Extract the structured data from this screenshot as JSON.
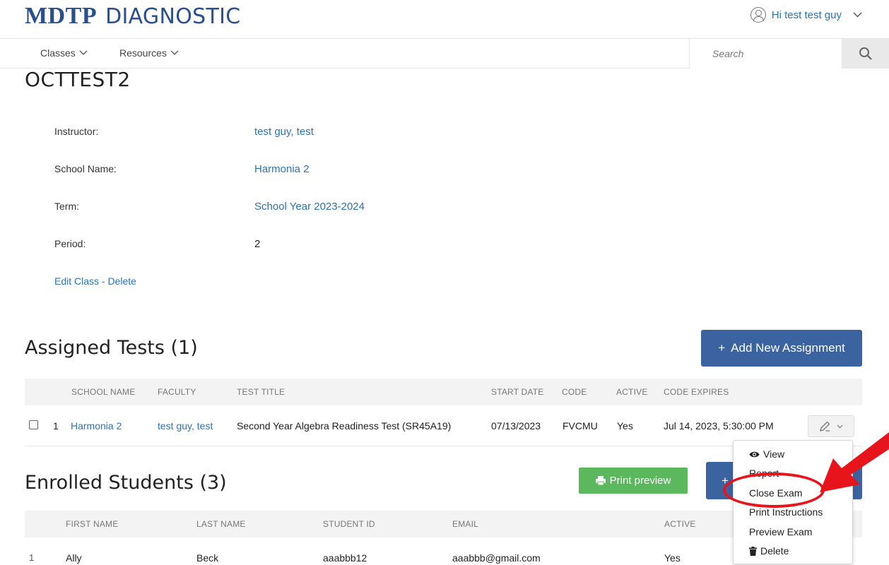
{
  "header": {
    "logo_main": "MDTP",
    "logo_sub": "DIAGNOSTIC",
    "user_greeting": "Hi test test guy"
  },
  "nav": {
    "classes": "Classes",
    "resources": "Resources",
    "search_placeholder": "Search"
  },
  "page": {
    "title": "OCTTEST2"
  },
  "class_info": {
    "instructor_label": "Instructor:",
    "instructor_value": "test guy, test",
    "school_label": "School Name:",
    "school_value": "Harmonia 2",
    "term_label": "Term:",
    "term_value": "School Year 2023-2024",
    "period_label": "Period:",
    "period_value": "2",
    "edit_link": "Edit Class",
    "separator": " - ",
    "delete_link": "Delete"
  },
  "assigned": {
    "title": "Assigned Tests (1)",
    "add_button": "Add New Assignment",
    "add_plus": "+",
    "columns": [
      "SCHOOL NAME",
      "FACULTY",
      "TEST TITLE",
      "START DATE",
      "CODE",
      "ACTIVE",
      "CODE EXPIRES"
    ],
    "rows": [
      {
        "index": "1",
        "school": "Harmonia 2",
        "faculty": "test guy, test",
        "test_title": "Second Year Algebra Readiness Test (SR45A19)",
        "start_date": "07/13/2023",
        "code": "FVCMU",
        "active": "Yes",
        "code_expires": "Jul 14, 2023, 5:30:00 PM"
      }
    ]
  },
  "action_menu": {
    "view": "View",
    "report": "Report",
    "close_exam": "Close Exam",
    "print_instructions": "Print Instructions",
    "preview_exam": "Preview Exam",
    "delete": "Delete"
  },
  "enrolled": {
    "title": "Enrolled Students (3)",
    "print_preview": "Print preview",
    "add_plus": "+",
    "columns": [
      "FIRST NAME",
      "LAST NAME",
      "STUDENT ID",
      "EMAIL",
      "ACTIVE"
    ],
    "rows": [
      {
        "index": "1",
        "first": "Ally",
        "last": "Beck",
        "student_id": "aaabbb12",
        "email": "aaabbb@gmail.com",
        "active": "Yes"
      }
    ]
  },
  "colors": {
    "brand": "#2a4f8f",
    "link": "#2a73b8",
    "primary_button": "#3b63a0",
    "green_button": "#5cb85c",
    "annotation": "#e8141b"
  }
}
